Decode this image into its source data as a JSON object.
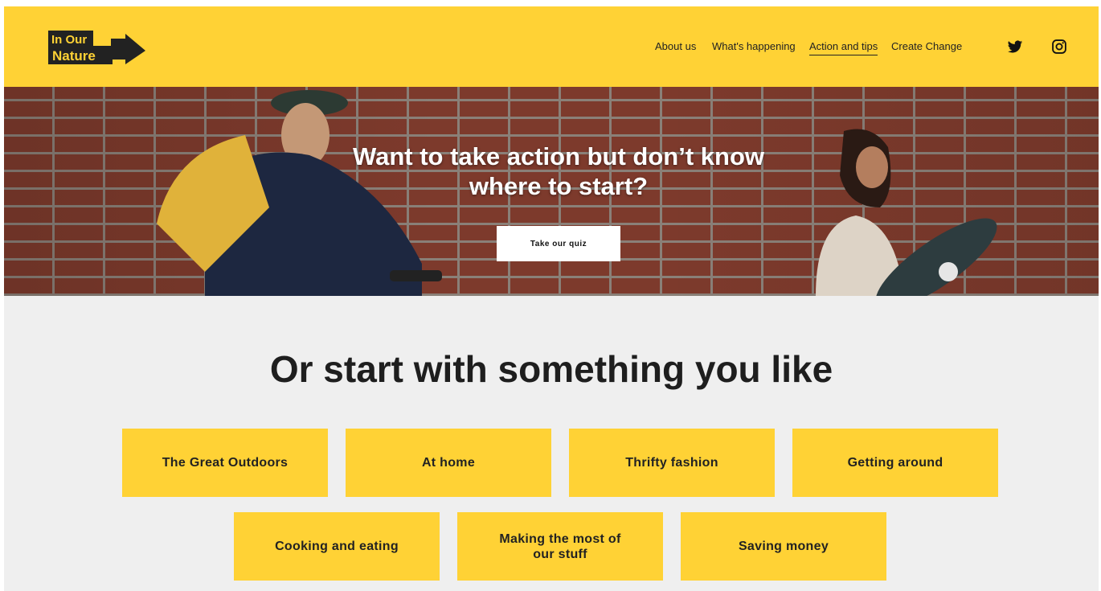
{
  "brand": {
    "logo_line1": "In Our",
    "logo_line2": "Nature",
    "primary_color": "#ffd235",
    "logo_color": "#222222"
  },
  "nav": {
    "items": [
      {
        "label": "About us",
        "active": false
      },
      {
        "label": "What's happening",
        "active": false
      },
      {
        "label": "Action and tips",
        "active": true
      },
      {
        "label": "Create Change",
        "active": false
      }
    ],
    "social_icons": [
      "twitter-icon",
      "instagram-icon"
    ]
  },
  "hero": {
    "title": "Want to take action but don’t know where to start?",
    "button_label": "Take our quiz"
  },
  "categories": {
    "title": "Or start with something you like",
    "items": [
      "The Great Outdoors",
      "At home",
      "Thrifty fashion",
      "Getting around",
      "Cooking and eating",
      "Making the most of our stuff",
      "Saving money"
    ]
  }
}
